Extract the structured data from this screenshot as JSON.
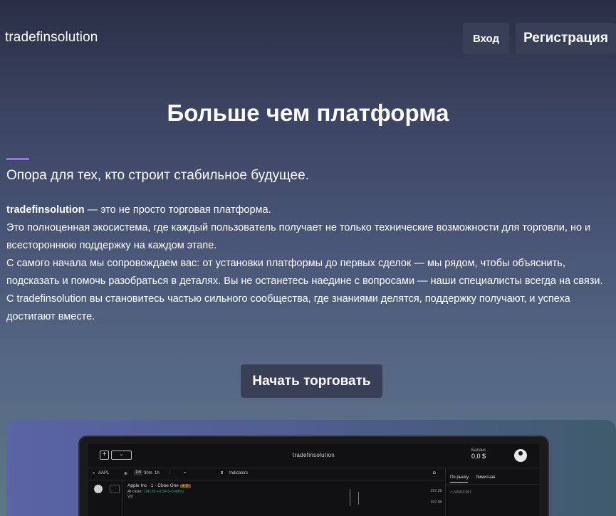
{
  "header": {
    "logo": "tradefinsolution",
    "login_label": "Вход",
    "register_label": "Регистрация"
  },
  "hero": {
    "title": "Больше чем платформа",
    "subtitle": "Опора для тех, кто строит стабильное будущее.",
    "brand": "tradefinsolution",
    "lines": [
      " — это не просто торговая платформа.",
      "Это полноценная экосистема, где каждый пользователь получает не только технические возможности для торговли, но и всестороннюю поддержку на каждом этапе.",
      "С самого начала мы сопровождаем вас: от установки платформы до первых сделок — мы рядом, чтобы объяснить, подсказать и помочь разобраться в деталях. Вы не останетесь наедине с вопросами — наши специалисты всегда на связи.",
      "С tradefinsolution вы становитесь частью сильного сообщества, где знаниями делятся, поддержку получают, и успеха достигают вместе."
    ],
    "cta_label": "Начать торговать"
  },
  "preview": {
    "app_name": "tradefinsolution",
    "balance_label": "Баланс",
    "balance_value": "0,0 $",
    "toolbar": {
      "symbol": "AAPL",
      "tf_1m": "1m",
      "tf_30m": "30m",
      "tf_1h": "1h",
      "indicators": "Indicators"
    },
    "ticker": "Apple Inc · 1 · Cboe One",
    "at_close_label": "At close:",
    "at_close_value": "196.26 +0.94 (+0.48%)",
    "vol_label": "Vol",
    "prices": [
      "197.20",
      "197.00"
    ],
    "tabs": [
      "По рынку",
      "Лимитная"
    ],
    "field_label": "WAR0.001"
  },
  "colors": {
    "button_bg": "#3a3f58",
    "accent": "#8b7ad0",
    "positive": "#2ca579",
    "badge": "#f2a33a"
  }
}
